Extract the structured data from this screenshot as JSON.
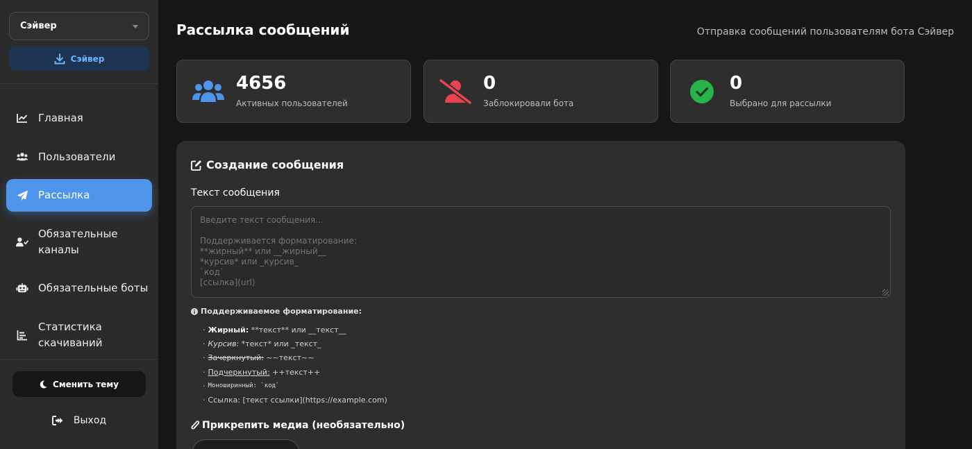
{
  "sidebar": {
    "bot_select": "Сэйвер",
    "download_label": "Сэйвер",
    "nav": [
      {
        "icon": "chart-line-icon",
        "label": "Главная",
        "active": false
      },
      {
        "icon": "users-icon",
        "label": "Пользователи",
        "active": false
      },
      {
        "icon": "paper-plane-icon",
        "label": "Рассылка",
        "active": true
      },
      {
        "icon": "user-check-icon",
        "label": "Обязательные\nканалы",
        "active": false
      },
      {
        "icon": "robot-icon",
        "label": "Обязательные боты",
        "active": false
      },
      {
        "icon": "chart-bar-icon",
        "label": "Статистика\nскачиваний",
        "active": false
      }
    ],
    "theme_button": "Сменить тему",
    "logout": "Выход"
  },
  "header": {
    "title": "Рассылка сообщений",
    "subtitle": "Отправка сообщений пользователям бота Сэйвер"
  },
  "stats": [
    {
      "icon": "users-icon",
      "value": "4656",
      "label": "Активных пользователей",
      "color": "#4d95ea"
    },
    {
      "icon": "user-slash-icon",
      "value": "0",
      "label": "Заблокировали бота",
      "color": "#e8434f"
    },
    {
      "icon": "check-circle-icon",
      "value": "0",
      "label": "Выбрано для рассылки",
      "color": "#29b34a"
    }
  ],
  "compose": {
    "title": "Создание сообщения",
    "text_label": "Текст сообщения",
    "placeholder": "Введите текст сообщения...\n\nПоддерживается форматирование:\n**жирный** или __жирный__\n*курсив* или _курсив_\n`код`\n[ссылка](url)",
    "formatting_head": "Поддерживаемое форматирование:",
    "formatting": {
      "bold_name": "Жирный:",
      "bold_syntax": " **текст** или __текст__",
      "italic_name": "Курсив:",
      "italic_syntax": " *текст* или _текст_",
      "strike_name": "Зачеркнутый:",
      "strike_syntax": " ~~текст~~",
      "under_name": "Подчеркнутый:",
      "under_syntax": " ++текст++",
      "mono_name": "Моноширинный:",
      "mono_syntax": " `код`",
      "link": "Ссылка: [текст ссылки](https://example.com)"
    },
    "attach_label": "Прикрепить медиа (необязательно)"
  },
  "colors": {
    "accent": "#4d95ea",
    "danger": "#e8434f",
    "success": "#29b34a"
  }
}
